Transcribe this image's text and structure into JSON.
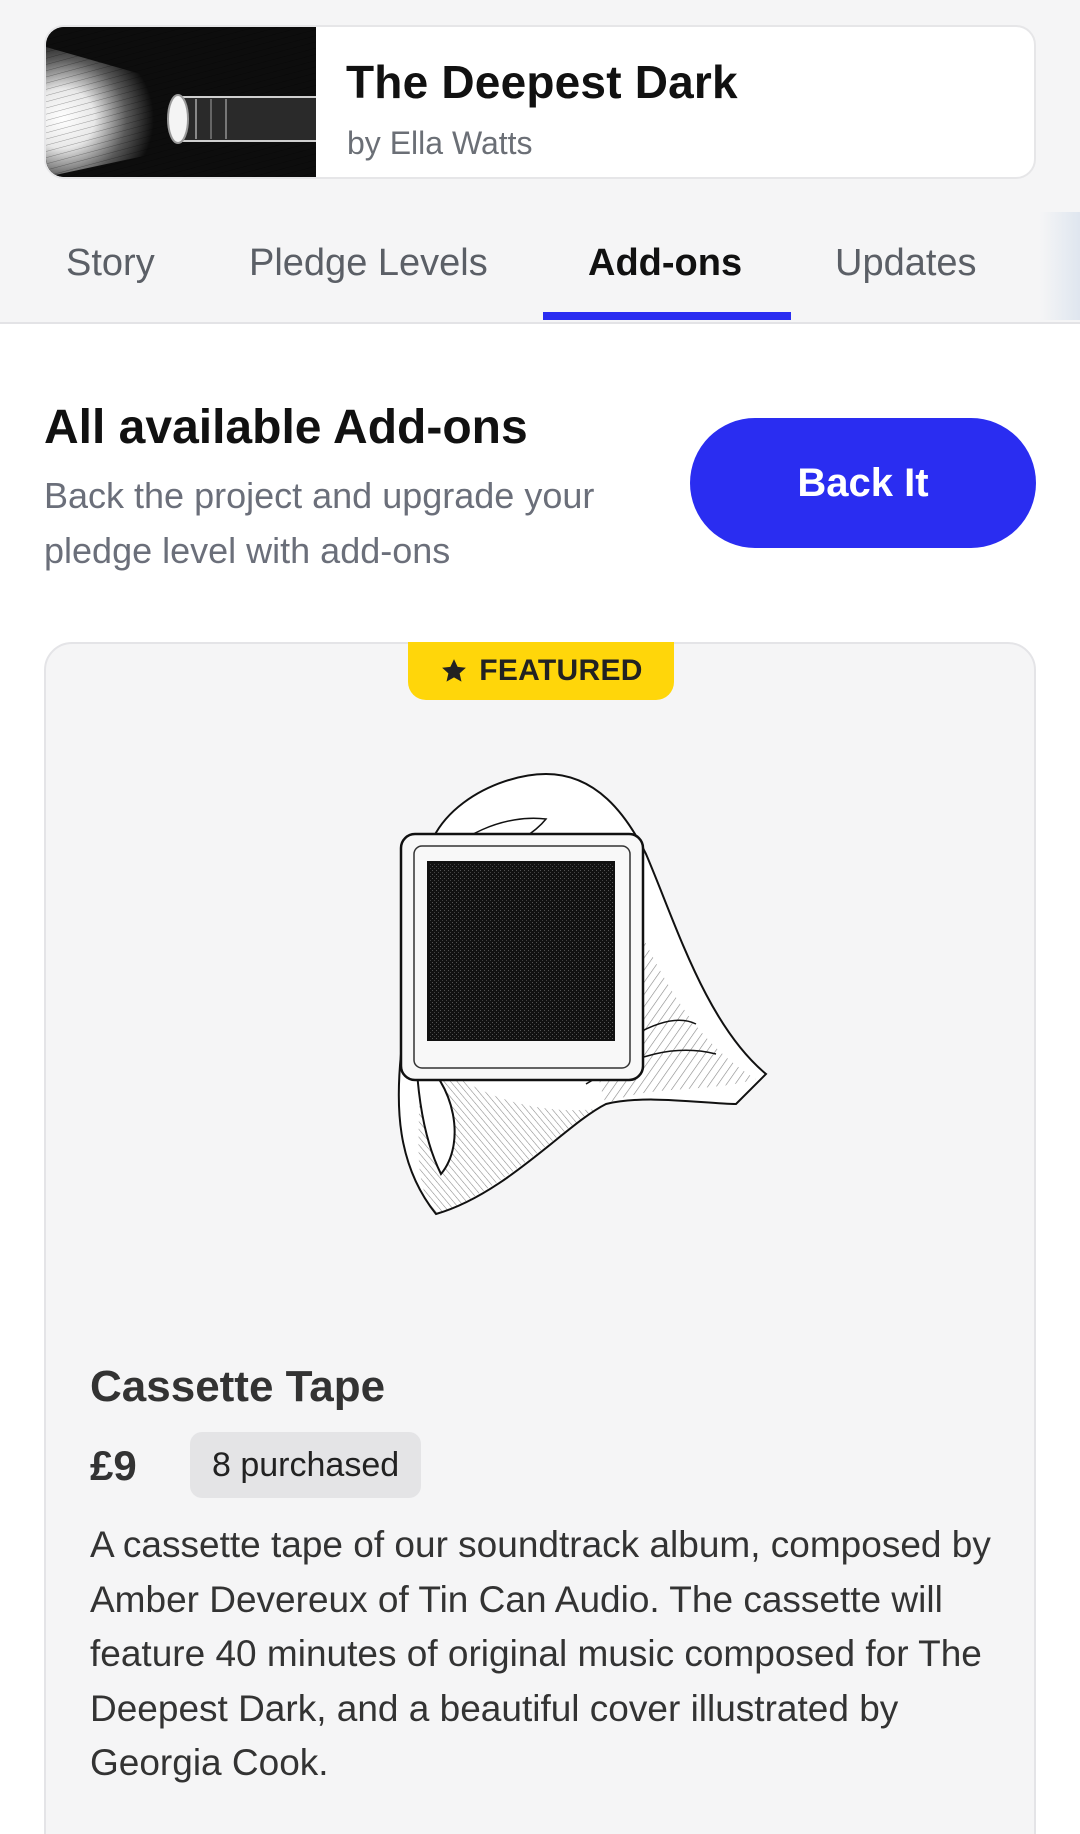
{
  "project": {
    "title": "The Deepest Dark",
    "author": "by Ella Watts"
  },
  "tabs": [
    {
      "label": "Story",
      "active": false
    },
    {
      "label": "Pledge Levels",
      "active": false
    },
    {
      "label": "Add-ons",
      "active": true
    },
    {
      "label": "Updates",
      "active": false
    }
  ],
  "section": {
    "title": "All available Add-ons",
    "subtitle": "Back the project and upgrade your pledge level with add-ons",
    "back_button": "Back It"
  },
  "addon": {
    "badge_icon": "star-icon",
    "badge": "FEATURED",
    "image_icon": "hooded-figure-illustration",
    "title": "Cassette Tape",
    "price": "£9",
    "purchased": "8 purchased",
    "description": "A cassette tape of our soundtrack album, composed by Amber Devereux of Tin Can Audio. The cassette will feature 40 minutes of original music composed for The Deepest Dark, and a beautiful cover illustrated by Georgia Cook."
  },
  "colors": {
    "accent": "#2a2df1",
    "badge": "#ffd60a",
    "card_bg": "#f5f5f6"
  }
}
